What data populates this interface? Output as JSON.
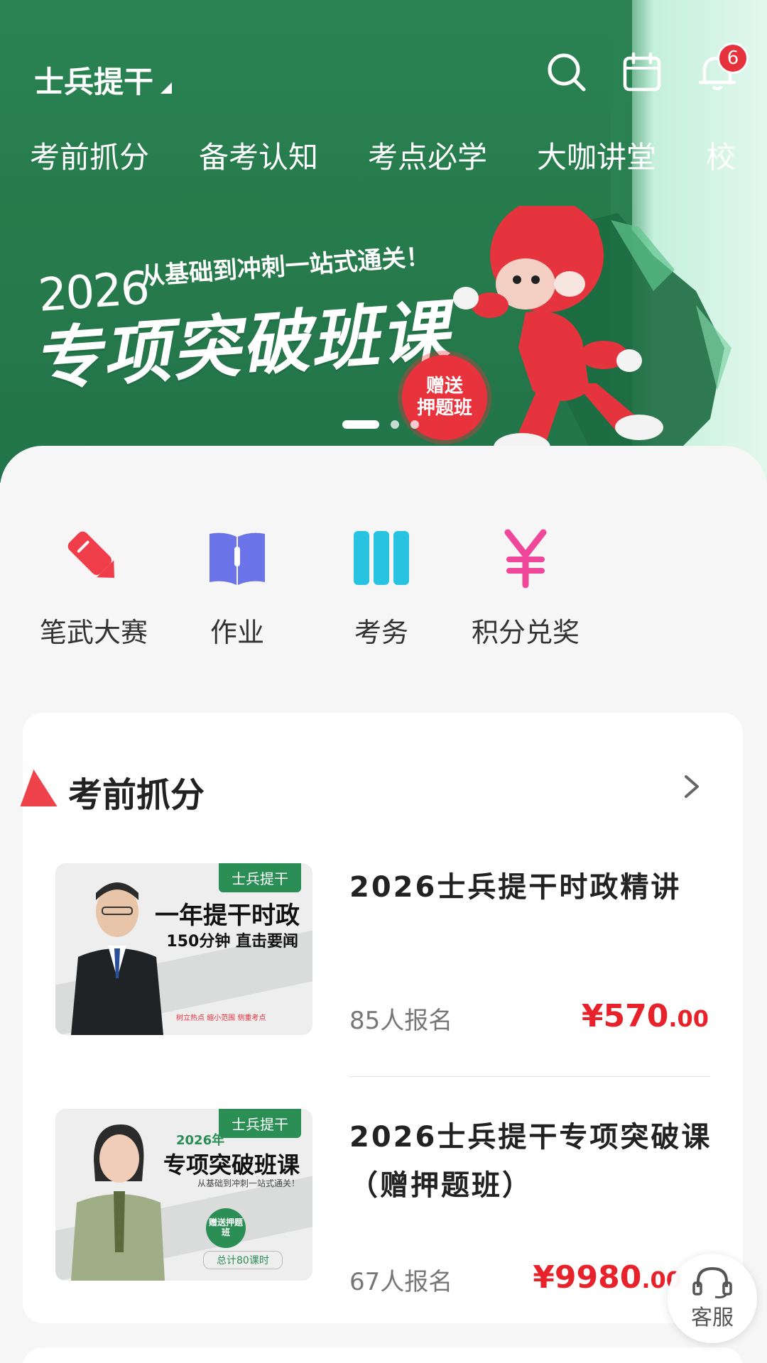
{
  "header": {
    "title": "士兵提干",
    "notification_count": "6",
    "tabs": [
      "考前抓分",
      "备考认知",
      "考点必学",
      "大咖讲堂",
      "校"
    ]
  },
  "banner": {
    "year": "2026",
    "subtitle": "从基础到冲刺一站式通关！",
    "title": "专项突破班课",
    "stamp_line1": "赠送",
    "stamp_line2": "押题班",
    "slides_total": 3,
    "active_slide": 1
  },
  "quick_actions": [
    {
      "label": "笔武大赛",
      "icon": "pencil-icon",
      "color": "#ef3e4a"
    },
    {
      "label": "作业",
      "icon": "book-icon",
      "color": "#6b74e8"
    },
    {
      "label": "考务",
      "icon": "columns-icon",
      "color": "#27c3e0"
    },
    {
      "label": "积分兑奖",
      "icon": "yen-icon",
      "color": "#f0479a"
    }
  ],
  "section": {
    "title": "考前抓分",
    "courses": [
      {
        "title": "2026士兵提干时政精讲",
        "enrolled": "85人报名",
        "price_main": "¥570",
        "price_cents": ".00",
        "thumb": {
          "tag": "士兵提干",
          "line1": "一年提干时政",
          "line2": "150分钟 直击要闻",
          "features": "树立热点  缩小范围  侧重考点"
        }
      },
      {
        "title": "2026士兵提干专项突破课（赠押题班）",
        "enrolled": "67人报名",
        "price_main": "¥9980",
        "price_cents": ".00",
        "thumb": {
          "tag": "士兵提干",
          "year": "2026年",
          "line1": "专项突破班课",
          "line2": "从基础到冲刺一站式通关！",
          "seal": "赠送押题班",
          "hours": "总计80课时"
        }
      }
    ]
  },
  "service": {
    "label": "客服"
  },
  "colors": {
    "brand_green": "#2a8252",
    "price_red": "#e8222b",
    "accent_red": "#ec2f37"
  }
}
